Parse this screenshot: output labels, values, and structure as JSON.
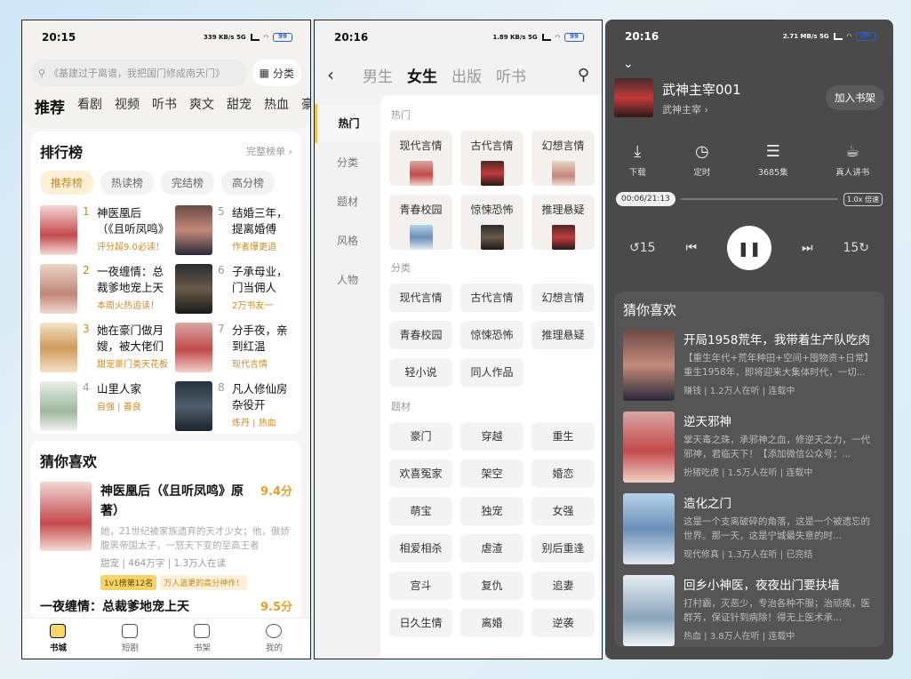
{
  "phone1": {
    "status": {
      "time": "20:15",
      "net": "339 KB/s 5G"
    },
    "search": {
      "placeholder": "《基建过于离谱，我把国门修成南天门》",
      "category_label": "分类"
    },
    "tabs": [
      "推荐",
      "看剧",
      "视频",
      "听书",
      "爽文",
      "甜宠",
      "热血",
      "豪门"
    ],
    "ranking": {
      "title": "排行榜",
      "more": "完整榜单 ›",
      "tabs": [
        "推荐榜",
        "热读榜",
        "完结榜",
        "高分榜"
      ],
      "items": [
        {
          "num": "1",
          "title": "神医凰后（《且听凤鸣》原著）",
          "sub": "评分超9.0必读！"
        },
        {
          "num": "5",
          "title": "结婚三年，提离婚傅",
          "sub": "作者爆更追"
        },
        {
          "num": "2",
          "title": "一夜缠情：总裁爹地宠上天",
          "sub": "本周火热追读！"
        },
        {
          "num": "6",
          "title": "子承母业，门当佣人",
          "sub": "2万书友一"
        },
        {
          "num": "3",
          "title": "她在豪门做月嫂，被大佬们抢疯！",
          "sub": "甜宠豪门类天花板"
        },
        {
          "num": "7",
          "title": "分手夜，亲到红温",
          "sub": "现代言情"
        },
        {
          "num": "4",
          "title": "山里人家",
          "sub": "自强 | 善良"
        },
        {
          "num": "8",
          "title": "凡人修仙房杂役开",
          "sub": "炼丹 | 热血"
        }
      ]
    },
    "guess": {
      "title": "猜你喜欢",
      "items": [
        {
          "name": "神医凰后（《且听凤鸣》原著）",
          "score": "9.4分",
          "desc": "她，21世纪被家族遗弃的天才少女；他，傲娇腹黑帝国太子，一怒天下变的至高王者",
          "meta": "甜宠 | 464万字 | 1.3万人在读",
          "badge1": "1v1榜第12名",
          "badge2": "万人追更的高分神作！"
        },
        {
          "name": "一夜缠情：总裁爹地宠上天",
          "score": "9.5分"
        }
      ]
    },
    "nav": [
      "书城",
      "短剧",
      "书架",
      "我的"
    ]
  },
  "phone2": {
    "status": {
      "time": "20:16",
      "net": "1.89 KB/s 5G"
    },
    "tabs": [
      "男生",
      "女生",
      "出版",
      "听书"
    ],
    "active_tab": "女生",
    "side": [
      "热门",
      "分类",
      "题材",
      "风格",
      "人物"
    ],
    "sections": {
      "hot_title": "热门",
      "hot": [
        "现代言情",
        "古代言情",
        "幻想言情",
        "青春校园",
        "惊悚恐怖",
        "推理悬疑"
      ],
      "cat_title": "分类",
      "cats": [
        "现代言情",
        "古代言情",
        "幻想言情",
        "青春校园",
        "惊悚恐怖",
        "推理悬疑",
        "轻小说",
        "同人作品"
      ],
      "theme_title": "题材",
      "themes": [
        "豪门",
        "穿越",
        "重生",
        "欢喜冤家",
        "架空",
        "婚恋",
        "萌宝",
        "独宠",
        "女强",
        "相爱相杀",
        "虐渣",
        "别后重逢",
        "宫斗",
        "复仇",
        "追妻",
        "日久生情",
        "离婚",
        "逆袭"
      ]
    }
  },
  "phone3": {
    "status": {
      "time": "20:16",
      "net": "2.71 MB/s 5G"
    },
    "book": {
      "name": "武神主宰001",
      "author": "武神主宰 ›",
      "shelf_btn": "加入书架"
    },
    "controls": [
      "下载",
      "定时",
      "3685集",
      "真人讲书"
    ],
    "progress": {
      "time": "00:06/21:13",
      "speed": "倍速",
      "speed_val": "1.0x"
    },
    "guess": {
      "title": "猜你喜欢",
      "items": [
        {
          "name": "开局1958荒年，我带着生产队吃肉",
          "desc": "【重生年代+荒年种田+空间+囤物资+日常】重生1958年，即将迎来大集体时代，一切...",
          "meta": "赚钱 | 1.2万人在听 | 连载中"
        },
        {
          "name": "逆天邪神",
          "desc": "掌天毒之珠，承邪神之血，修逆天之力，一代邪神，君临天下！【添加微信公众号：...",
          "meta": "扮猪吃虎 | 1.5万人在听 | 连载中"
        },
        {
          "name": "造化之门",
          "desc": "这是一个支离破碎的角落，这是一个被遗忘的世界。那一天，这是宁城最失意的时...",
          "meta": "现代修真 | 1.3万人在听 | 已完结"
        },
        {
          "name": "回乡小神医，夜夜出门要扶墙",
          "desc": "打村霸，灭恶少，专治各种不服；治顽疾，医群芳，保证针到病除！得无上医术承...",
          "meta": "热血 | 3.8万人在听 | 连载中"
        }
      ]
    }
  }
}
